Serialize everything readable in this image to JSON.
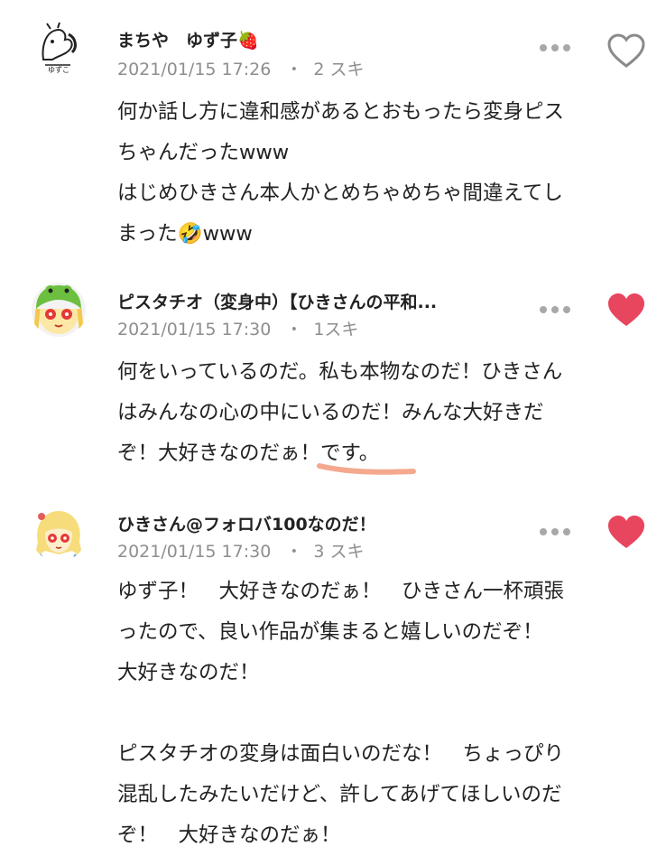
{
  "comments": [
    {
      "author": "まちや　ゆず子🍓",
      "date": "2021/01/15 17:26",
      "likes": "2 スキ",
      "liked": false,
      "text": "何か話し方に違和感があるとおもったら変身ピス\nちゃんだったwww\nはじめひきさん本人かとめちゃめちゃ間違えてし\nまった🤣www"
    },
    {
      "author": "ピスタチオ（変身中）【ひきさんの平和...",
      "date": "2021/01/15 17:30",
      "likes": "1スキ",
      "liked": true,
      "text": "何をいっているのだ。私も本物なのだ！ひきさん\nはみんなの心の中にいるのだ！みんな大好きだ\nぞ！大好きなのだぁ！です。"
    },
    {
      "author": "ひきさん@フォロバ100なのだ！",
      "date": "2021/01/15 17:30",
      "likes": "3 スキ",
      "liked": true,
      "text": "ゆず子！　大好きなのだぁ！　ひきさん一杯頑張\nったので、良い作品が集まると嬉しいのだぞ！\n大好きなのだ！\n\nピスタチオの変身は面白いのだな！　ちょっぴり\n混乱したみたいだけど、許してあげてほしいのだ\nぞ！　大好きなのだぁ！"
    }
  ],
  "icons": {
    "more": "more-options-icon",
    "heart_outline": "heart-outline-icon",
    "heart_filled": "heart-filled-icon"
  },
  "colors": {
    "heart_liked": "#e8455e",
    "heart_outline": "#8a8a8a",
    "meta_gray": "#8e8e8e",
    "underline_mark": "#f4a98f"
  }
}
